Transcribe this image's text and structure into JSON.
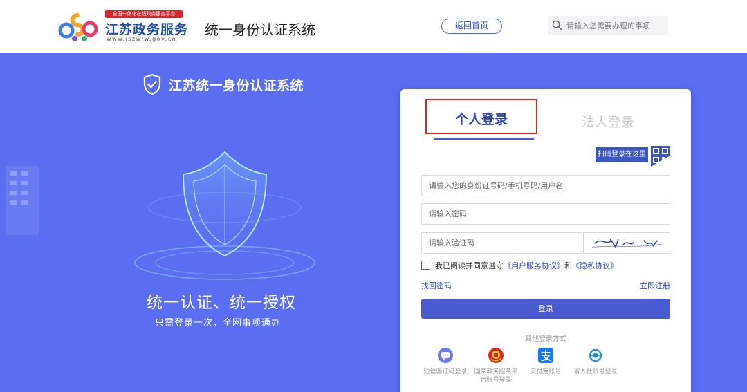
{
  "header": {
    "slogan_badge": "全国一体化在线政务服务平台",
    "brand_name": "江苏政务服务",
    "brand_url": "www.jszwfw.gov.cn",
    "system_title": "统一身份认证系统",
    "home_button": "返回首页",
    "search_placeholder": "请输入您需要办理的事项"
  },
  "hero": {
    "title": "江苏统一身份认证系统",
    "slogan": "统一认证、统一授权",
    "subtitle": "只需登录一次，全网事项通办"
  },
  "login": {
    "tab_personal": "个人登录",
    "tab_legal": "法人登录",
    "qr_tag": "扫码登录在这里",
    "account_placeholder": "请输入您的身份证号码/手机号码/用户名",
    "password_placeholder": "请输入密码",
    "captcha_placeholder": "请输入验证码",
    "agree_prefix": "我已阅读并同意遵守",
    "agree_link_service": "《用户服务协议》",
    "agree_and": "和",
    "agree_link_privacy": "《隐私协议》",
    "forgot_password": "找回密码",
    "register": "立即注册",
    "login_button": "登录",
    "other_title": "其他登录方式",
    "alt_methods": [
      {
        "label": "短信验证码登录",
        "icon": "sms-icon"
      },
      {
        "label": "国家政务服务平台账号登录",
        "icon": "national-emblem-icon"
      },
      {
        "label": "支付宝账号",
        "icon": "alipay-icon"
      },
      {
        "label": "省人社账号登录",
        "icon": "social-security-icon"
      }
    ]
  },
  "colors": {
    "background": "#5b6df0",
    "primary": "#4a5ad0",
    "link": "#2f46b8",
    "highlight_border": "#e0241b"
  }
}
